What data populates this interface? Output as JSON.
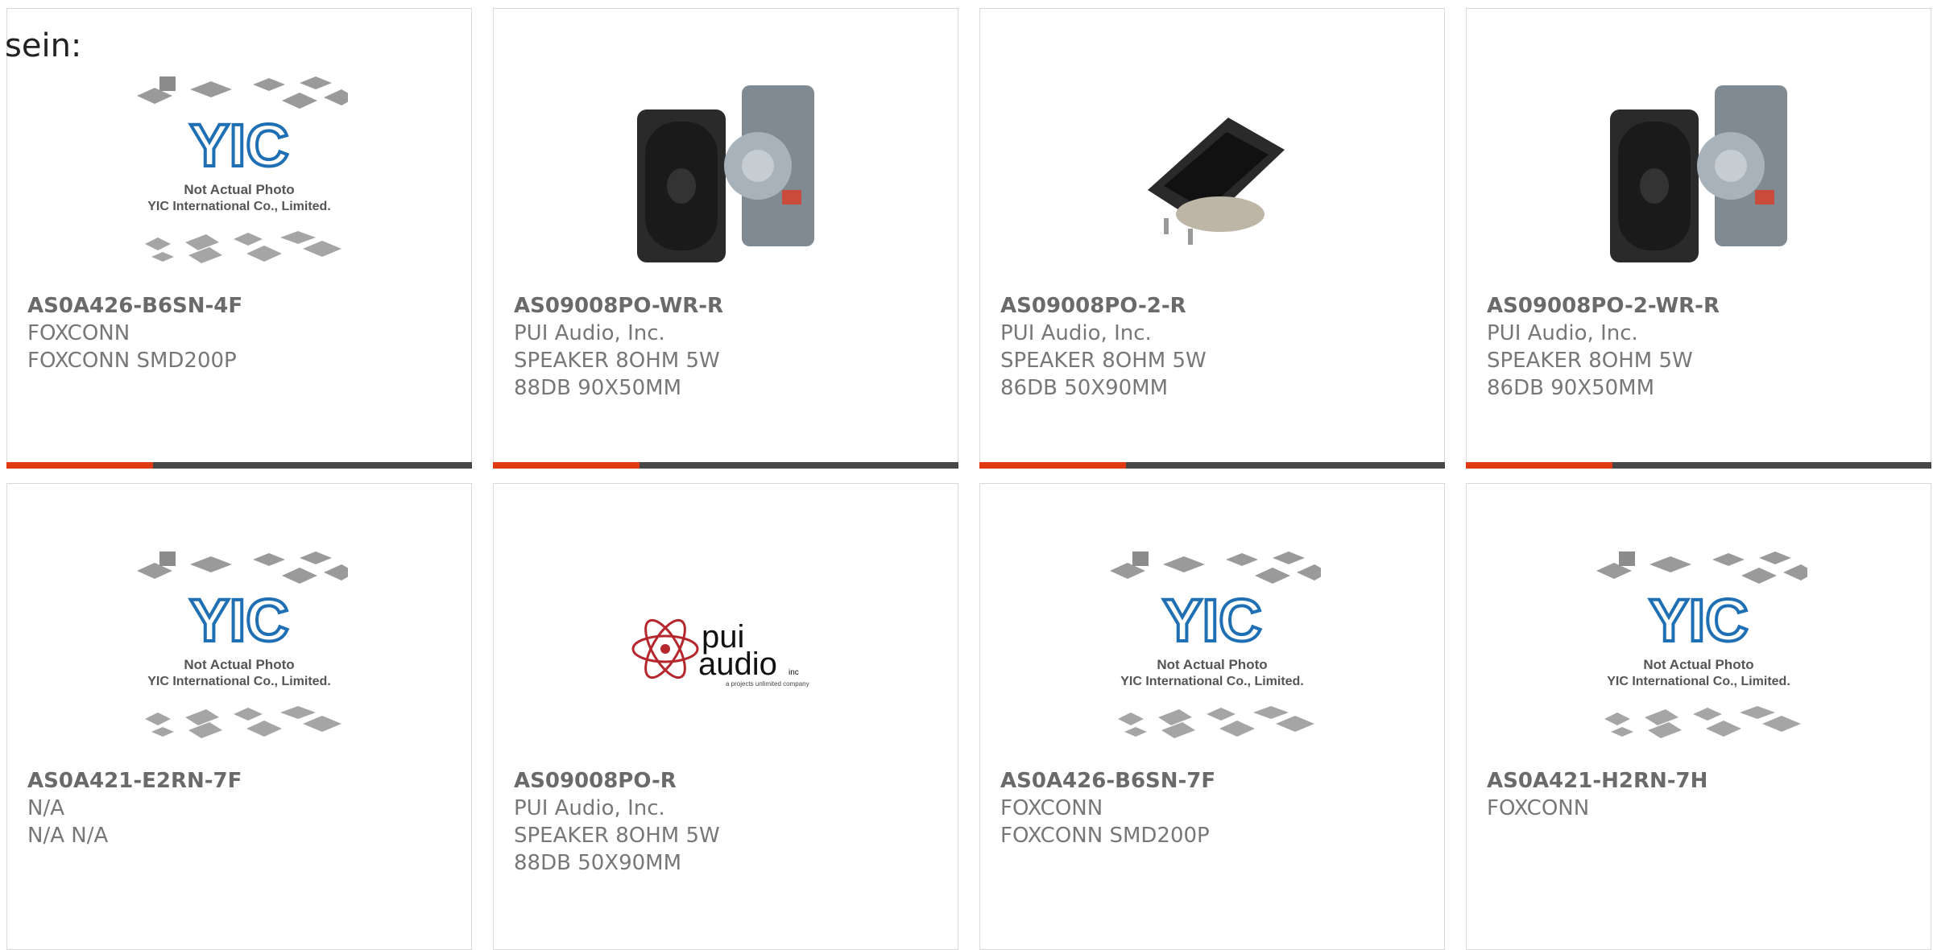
{
  "header": {
    "text": "sein:"
  },
  "colors": {
    "accent": "#e03a12",
    "bar": "#474747",
    "yic_blue": "#1f6fb5",
    "pui_red": "#b5272d"
  },
  "products": [
    {
      "part": "AS0A426-B6SN-4F",
      "manufacturer": "FOXCONN",
      "description": "FOXCONN SMD200P",
      "image": "yic-placeholder"
    },
    {
      "part": "AS09008PO-WR-R",
      "manufacturer": "PUI Audio, Inc.",
      "description": "SPEAKER 8OHM 5W 88DB 90X50MM",
      "image": "speaker-with-side"
    },
    {
      "part": "AS09008PO-2-R",
      "manufacturer": "PUI Audio, Inc.",
      "description": "SPEAKER 8OHM 5W 86DB 50X90MM",
      "image": "speaker-angled"
    },
    {
      "part": "AS09008PO-2-WR-R",
      "manufacturer": "PUI Audio, Inc.",
      "description": "SPEAKER 8OHM 5W 86DB 90X50MM",
      "image": "speaker-with-side"
    },
    {
      "part": "AS0A421-E2RN-7F",
      "manufacturer": "N/A",
      "description": "N/A N/A",
      "image": "yic-placeholder"
    },
    {
      "part": "AS09008PO-R",
      "manufacturer": "PUI Audio, Inc.",
      "description": "SPEAKER 8OHM 5W 88DB 50X90MM",
      "image": "pui-audio-logo"
    },
    {
      "part": "AS0A426-B6SN-7F",
      "manufacturer": "FOXCONN",
      "description": "FOXCONN SMD200P",
      "image": "yic-placeholder"
    },
    {
      "part": "AS0A421-H2RN-7H",
      "manufacturer": "FOXCONN",
      "description": "",
      "image": "yic-placeholder"
    }
  ],
  "yic_placeholder": {
    "logo_text": "YIC",
    "line1": "Not Actual Photo",
    "line2": "YIC International Co., Limited."
  },
  "pui_logo": {
    "word1": "pui",
    "word2": "audio",
    "suffix": "inc",
    "tagline": "a projects unlimited company"
  }
}
